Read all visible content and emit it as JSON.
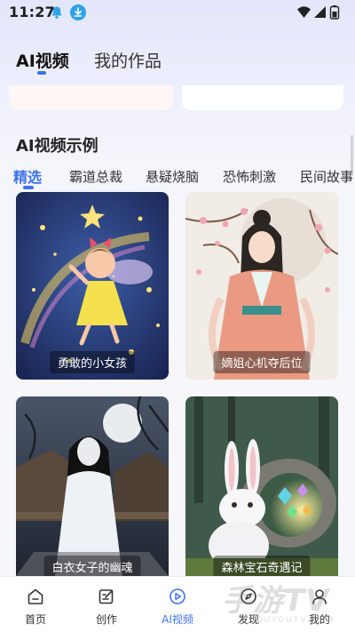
{
  "status_bar": {
    "time": "11:27",
    "icons": [
      "notification-bell-icon",
      "download-icon",
      "wifi-icon",
      "signal-icon",
      "battery-icon"
    ]
  },
  "top_tabs": [
    {
      "label": "AI视频",
      "active": true
    },
    {
      "label": "我的作品",
      "active": false
    }
  ],
  "section_title": "AI视频示例",
  "category_tabs": [
    {
      "label": "精选",
      "active": true
    },
    {
      "label": "霸道总裁",
      "active": false
    },
    {
      "label": "悬疑烧脑",
      "active": false
    },
    {
      "label": "恐怖刺激",
      "active": false
    },
    {
      "label": "民间故事",
      "active": false
    }
  ],
  "cards": [
    {
      "title": "勇敢的小女孩",
      "image": "fairy-girl-with-wand-illustration"
    },
    {
      "title": "嫡姐心机夺后位",
      "image": "hanfu-lady-cherry-blossom-illustration"
    },
    {
      "title": "白衣女子的幽魂",
      "image": "white-dress-ghost-woman-night-village"
    },
    {
      "title": "森林宝石奇遇记",
      "image": "white-rabbit-gem-cave-forest"
    }
  ],
  "bottom_nav": [
    {
      "label": "首页",
      "icon": "home-icon",
      "active": false
    },
    {
      "label": "创作",
      "icon": "edit-icon",
      "active": false
    },
    {
      "label": "AI视频",
      "icon": "play-circle-icon",
      "active": true
    },
    {
      "label": "发现",
      "icon": "compass-icon",
      "active": false
    },
    {
      "label": "我的",
      "icon": "user-icon",
      "active": false
    }
  ],
  "watermark": {
    "big": "手游TV",
    "small": "SHOUYOUTV.COM"
  },
  "colors": {
    "accent": "#3b72f0",
    "download_badge": "#2fa3ea"
  }
}
